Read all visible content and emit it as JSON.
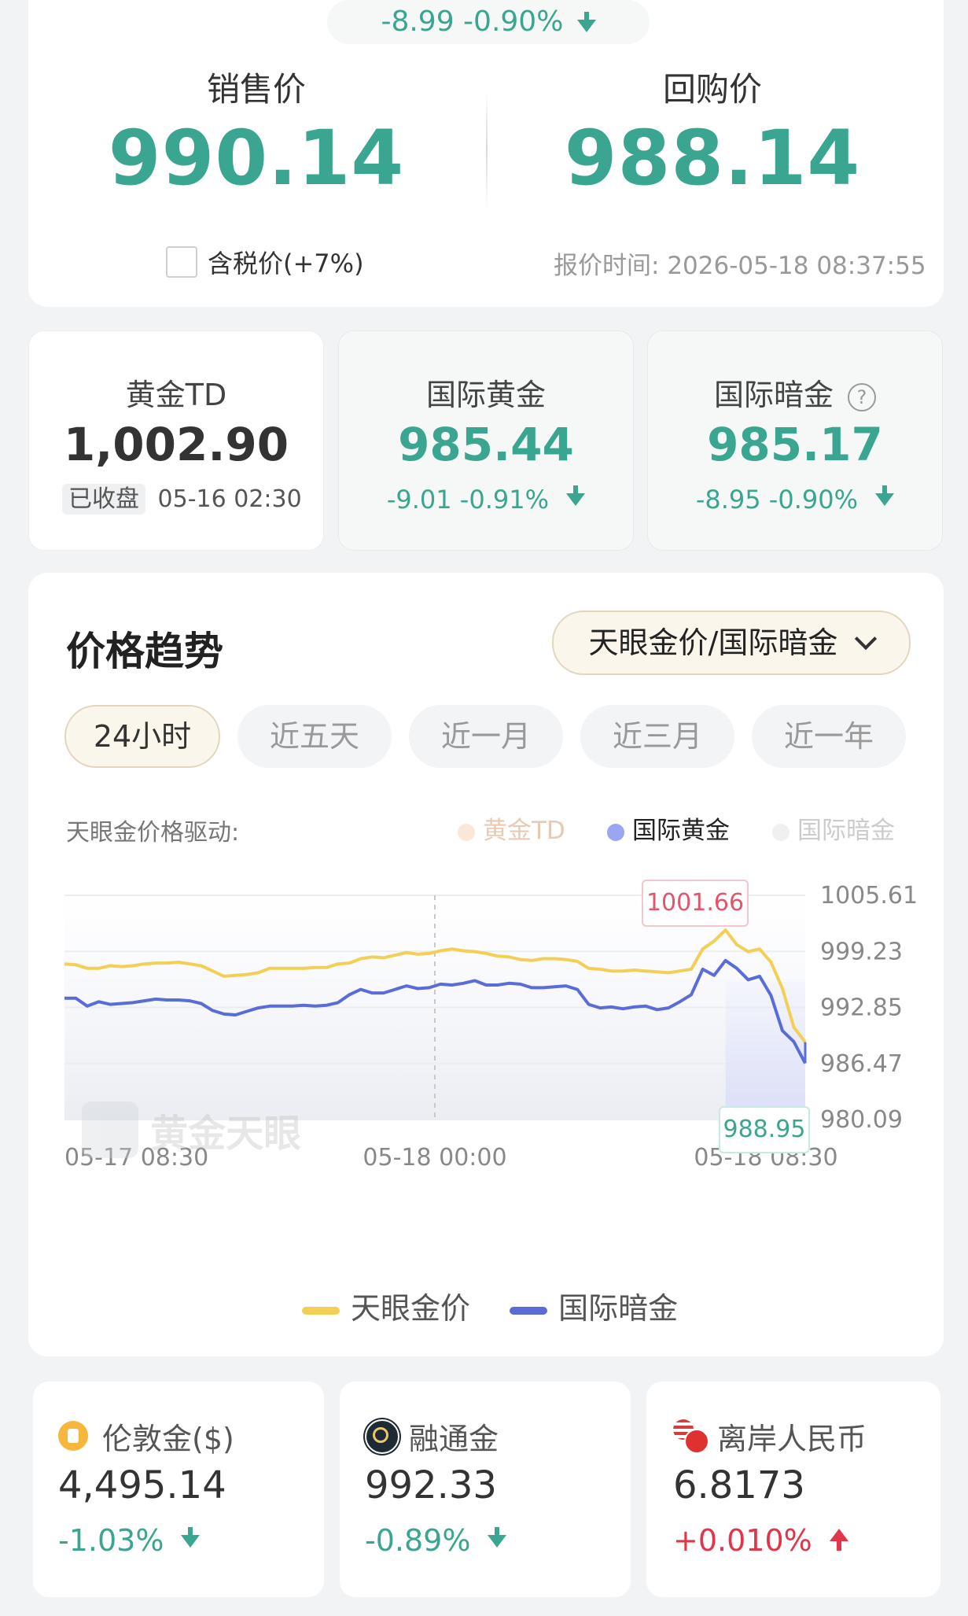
{
  "top_change": {
    "text": "-8.99 -0.90%"
  },
  "price_panel": {
    "sell_label": "销售价",
    "sell_value": "990.14",
    "buyback_label": "回购价",
    "buyback_value": "988.14",
    "tax_label": "含税价(+7%)",
    "quote_time_label": "报价时间:",
    "quote_time": "2026-05-18 08:37:55"
  },
  "mini_cards": [
    {
      "title": "黄金TD",
      "value": "1,002.90",
      "badge": "已收盘",
      "time": "05-16 02:30"
    },
    {
      "title": "国际黄金",
      "value": "985.44",
      "change": "-9.01 -0.91%"
    },
    {
      "title": "国际暗金",
      "value": "985.17",
      "change": "-8.95 -0.90%",
      "help_icon": "?"
    }
  ],
  "trend": {
    "title": "价格趋势",
    "selector": "天眼金价/国际暗金",
    "tabs": [
      "24小时",
      "近五天",
      "近一月",
      "近三月",
      "近一年"
    ],
    "active_tab": "24小时",
    "driver_label": "天眼金价格驱动:",
    "driver_legend": [
      {
        "name": "黄金TD",
        "color": "#f3c9a8",
        "active": false
      },
      {
        "name": "国际黄金",
        "color": "#8e9bf0",
        "active": true
      },
      {
        "name": "国际暗金",
        "color": "#d8d8d8",
        "active": false
      }
    ],
    "watermark": "黄金天眼",
    "tooltip_high": "1001.66",
    "tooltip_low": "988.95",
    "legend": [
      "天眼金价",
      "国际暗金"
    ]
  },
  "chart_data": {
    "type": "line",
    "x_ticks": [
      "05-17 08:30",
      "05-18 00:00",
      "05-18 08:30"
    ],
    "y_ticks": [
      "1005.61",
      "999.23",
      "992.85",
      "986.47",
      "980.09"
    ],
    "ylim": [
      980.09,
      1005.61
    ],
    "series": [
      {
        "name": "天眼金价",
        "color": "#f3cf55",
        "values": [
          997.8,
          997.7,
          997.3,
          997.3,
          997.6,
          997.5,
          997.6,
          997.8,
          997.9,
          997.9,
          998.0,
          997.8,
          997.6,
          997.0,
          996.4,
          996.5,
          996.6,
          996.8,
          997.3,
          997.3,
          997.3,
          997.3,
          997.4,
          997.4,
          997.8,
          997.9,
          998.4,
          998.6,
          998.5,
          998.8,
          999.1,
          998.9,
          999.0,
          999.3,
          999.5,
          999.3,
          999.2,
          999.0,
          998.7,
          998.6,
          998.3,
          998.2,
          998.4,
          998.4,
          998.3,
          998.1,
          997.3,
          997.2,
          997.0,
          997.0,
          997.1,
          997.0,
          996.9,
          996.8,
          997.0,
          997.2,
          999.5,
          1000.4,
          1001.66,
          1000.0,
          999.2,
          999.5,
          998.0,
          995.0,
          990.6,
          988.9
        ]
      },
      {
        "name": "国际暗金",
        "color": "#5a6cd8",
        "values": [
          993.9,
          993.9,
          993.0,
          993.5,
          993.2,
          993.3,
          993.4,
          993.6,
          993.8,
          993.7,
          993.7,
          993.6,
          993.3,
          992.5,
          992.1,
          992.0,
          992.4,
          992.8,
          993.0,
          993.0,
          993.0,
          993.1,
          993.0,
          993.1,
          993.4,
          994.3,
          994.9,
          994.5,
          994.5,
          994.9,
          995.3,
          995.0,
          995.1,
          995.5,
          995.4,
          995.6,
          995.9,
          995.4,
          995.4,
          995.6,
          995.5,
          995.1,
          995.1,
          995.2,
          995.3,
          994.9,
          993.2,
          992.8,
          992.9,
          992.7,
          992.9,
          993.0,
          992.6,
          992.8,
          993.5,
          994.3,
          997.2,
          996.5,
          998.2,
          997.3,
          996.0,
          996.4,
          994.2,
          990.2,
          988.95,
          986.5
        ]
      }
    ]
  },
  "bottom_cards": [
    {
      "title": "伦敦金($)",
      "value": "4,495.14",
      "change": "-1.03%",
      "direction": "down",
      "icon": "gold-coin-icon"
    },
    {
      "title": "融通金",
      "value": "992.33",
      "change": "-0.89%",
      "direction": "down",
      "icon": "rongtong-logo-icon"
    },
    {
      "title": "离岸人民币",
      "value": "6.8173",
      "change": "+0.010%",
      "direction": "up",
      "icon": "flags-icon"
    }
  ]
}
